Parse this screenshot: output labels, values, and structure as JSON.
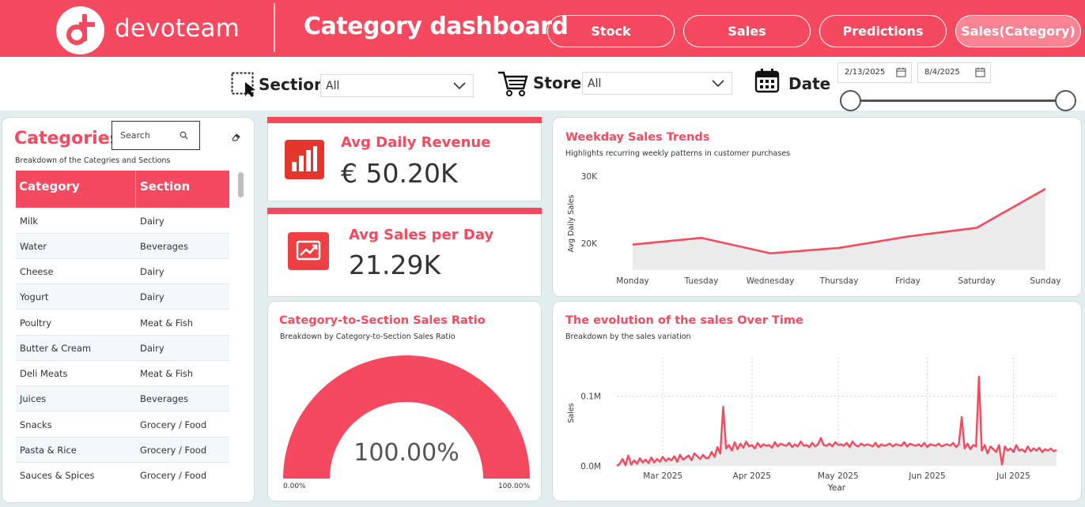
{
  "header": {
    "brand": "devoteam",
    "title": "Category dashboard",
    "nav": [
      {
        "label": "Stock"
      },
      {
        "label": "Sales"
      },
      {
        "label": "Predictions"
      },
      {
        "label": "Sales(Category)"
      }
    ],
    "active_nav": "Sales(Category)"
  },
  "filters": {
    "section_label": "Section",
    "section_value": "All",
    "store_label": "Store",
    "store_value": "All",
    "date_label": "Date",
    "date_start": "2/13/2025",
    "date_end": "8/4/2025"
  },
  "categories_panel": {
    "title": "Categories",
    "subtitle": "Breakdown of the Categries and Sections",
    "search_placeholder": "Search",
    "columns": [
      "Category",
      "Section"
    ],
    "rows": [
      [
        "Milk",
        "Dairy"
      ],
      [
        "Water",
        "Beverages"
      ],
      [
        "Cheese",
        "Dairy"
      ],
      [
        "Yogurt",
        "Dairy"
      ],
      [
        "Poultry",
        "Meat & Fish"
      ],
      [
        "Butter & Cream",
        "Dairy"
      ],
      [
        "Deli Meats",
        "Meat & Fish"
      ],
      [
        "Juices",
        "Beverages"
      ],
      [
        "Snacks",
        "Grocery / Food"
      ],
      [
        "Pasta & Rice",
        "Grocery / Food"
      ],
      [
        "Sauces & Spices",
        "Grocery / Food"
      ]
    ]
  },
  "kpis": {
    "revenue": {
      "title": "Avg Daily Revenue",
      "value": "€ 50.20K"
    },
    "sales": {
      "title": "Avg Sales per Day",
      "value": "21.29K"
    }
  },
  "gauge": {
    "title": "Category-to-Section Sales Ratio",
    "subtitle": "Breakdown by Category-to-Section Sales Ratio",
    "value_label": "100.00%",
    "min_label": "0.00%",
    "max_label": "100.00%",
    "fraction": 1.0
  },
  "weekday_chart": {
    "title": "Weekday Sales Trends",
    "subtitle": "Highlights recurring weekly patterns in customer purchases"
  },
  "evolution_chart": {
    "title": "The evolution of the sales Over Time",
    "subtitle": "Breakdown by the sales variation"
  },
  "colors": {
    "accent": "#f5495f",
    "area_fill": "#ececec",
    "kpi_icon": "#e5362e"
  },
  "chart_data": [
    {
      "type": "area",
      "categories": [
        "Monday",
        "Tuesday",
        "Wednesday",
        "Thursday",
        "Friday",
        "Saturday",
        "Sunday"
      ],
      "values": [
        19800,
        20800,
        18500,
        19300,
        21000,
        22300,
        28100
      ],
      "ylabel": "Avg Daily Sales",
      "yticks": [
        "20K",
        "30K"
      ],
      "ytick_values": [
        20000,
        30000
      ],
      "ylim": [
        16000,
        30000
      ]
    },
    {
      "type": "area",
      "xlabel": "Year",
      "ylabel": "Sales",
      "xticks": [
        "Mar 2025",
        "Apr 2025",
        "May 2025",
        "Jun 2025",
        "Jul 2025"
      ],
      "xtick_days": [
        16,
        47,
        77,
        108,
        138
      ],
      "yticks": [
        "0.0M",
        "0.1M"
      ],
      "ytick_values": [
        0,
        100000
      ],
      "ylim": [
        0,
        155000
      ],
      "x_days": [
        0,
        1,
        2,
        3,
        4,
        5,
        6,
        7,
        8,
        9,
        10,
        11,
        12,
        13,
        14,
        15,
        16,
        17,
        18,
        19,
        20,
        21,
        22,
        23,
        24,
        25,
        26,
        27,
        28,
        29,
        30,
        31,
        32,
        33,
        34,
        35,
        36,
        37,
        38,
        39,
        40,
        41,
        42,
        43,
        44,
        45,
        46,
        47,
        48,
        49,
        50,
        51,
        52,
        53,
        54,
        55,
        56,
        57,
        58,
        59,
        60,
        61,
        62,
        63,
        64,
        65,
        66,
        67,
        68,
        69,
        70,
        71,
        72,
        73,
        74,
        75,
        76,
        77,
        78,
        79,
        80,
        81,
        82,
        83,
        84,
        85,
        86,
        87,
        88,
        89,
        90,
        91,
        92,
        93,
        94,
        95,
        96,
        97,
        98,
        99,
        100,
        101,
        102,
        103,
        104,
        105,
        106,
        107,
        108,
        109,
        110,
        111,
        112,
        113,
        114,
        115,
        116,
        117,
        118,
        119,
        120,
        121,
        122,
        123,
        124,
        125,
        126,
        127,
        128,
        129,
        130,
        131,
        132,
        133,
        134,
        135,
        136,
        137,
        138,
        139,
        140,
        141,
        142,
        143,
        144,
        145,
        146,
        147,
        148,
        149,
        150,
        151,
        152,
        153
      ],
      "values": [
        0,
        3000,
        10000,
        1000,
        15000,
        2000,
        8000,
        3000,
        11000,
        5000,
        9000,
        4000,
        12000,
        5000,
        10000,
        6000,
        13000,
        7000,
        11000,
        8000,
        14000,
        6000,
        16000,
        9000,
        12000,
        15000,
        8000,
        18000,
        14000,
        10000,
        16000,
        11000,
        12000,
        20000,
        13000,
        27000,
        18000,
        85000,
        25000,
        30000,
        22000,
        34000,
        24000,
        32000,
        26000,
        35000,
        28000,
        30000,
        25000,
        33000,
        27000,
        31000,
        29000,
        30000,
        26000,
        34000,
        28000,
        32000,
        30000,
        29000,
        33000,
        27000,
        31000,
        28000,
        35000,
        29000,
        30000,
        27000,
        33000,
        28000,
        31000,
        40000,
        30000,
        29000,
        32000,
        28000,
        34000,
        30000,
        31000,
        29000,
        33000,
        27000,
        35000,
        30000,
        28000,
        32000,
        29000,
        31000,
        30000,
        28000,
        33000,
        27000,
        31000,
        29000,
        30000,
        32000,
        28000,
        31000,
        30000,
        29000,
        34000,
        28000,
        32000,
        30000,
        29000,
        31000,
        28000,
        33000,
        27000,
        31000,
        30000,
        29000,
        32000,
        28000,
        30000,
        31000,
        29000,
        33000,
        27000,
        31000,
        70000,
        25000,
        32000,
        24000,
        30000,
        28000,
        128000,
        22000,
        30000,
        18000,
        28000,
        24000,
        20000,
        30000,
        2000,
        28000,
        22000,
        25000,
        20000,
        30000,
        22000,
        24000,
        20000,
        28000,
        21000,
        25000,
        22000,
        26000,
        20000,
        24000,
        22000,
        25000,
        21000,
        23000
      ]
    }
  ]
}
